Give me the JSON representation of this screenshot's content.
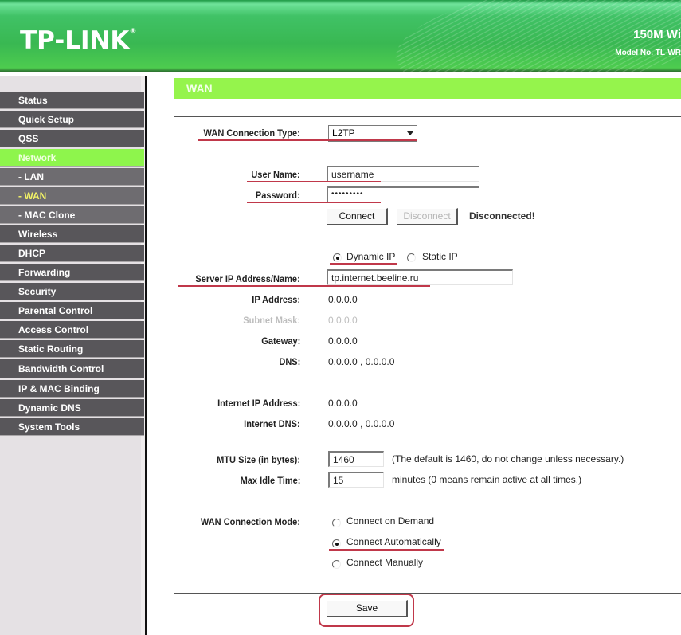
{
  "header": {
    "logo": "TP-LINK",
    "logo_mark": "®",
    "product_title": "150M Wi",
    "model_no": "Model No. TL-WR"
  },
  "sidebar": {
    "items": [
      {
        "label": "Status",
        "type": "top"
      },
      {
        "label": "Quick Setup",
        "type": "top"
      },
      {
        "label": "QSS",
        "type": "top"
      },
      {
        "label": "Network",
        "type": "active-parent"
      },
      {
        "label": "- LAN",
        "type": "sub"
      },
      {
        "label": "- WAN",
        "type": "sub-current"
      },
      {
        "label": "- MAC Clone",
        "type": "sub"
      },
      {
        "label": "Wireless",
        "type": "top"
      },
      {
        "label": "DHCP",
        "type": "top"
      },
      {
        "label": "Forwarding",
        "type": "top"
      },
      {
        "label": "Security",
        "type": "top"
      },
      {
        "label": "Parental Control",
        "type": "top"
      },
      {
        "label": "Access Control",
        "type": "top"
      },
      {
        "label": "Static Routing",
        "type": "top"
      },
      {
        "label": "Bandwidth Control",
        "type": "top"
      },
      {
        "label": "IP & MAC Binding",
        "type": "top"
      },
      {
        "label": "Dynamic DNS",
        "type": "top"
      },
      {
        "label": "System Tools",
        "type": "top"
      }
    ]
  },
  "main": {
    "section_title": "WAN",
    "connection_type": {
      "label": "WAN Connection Type:",
      "value": "L2TP"
    },
    "user_name": {
      "label": "User Name:",
      "value": "username"
    },
    "password": {
      "label": "Password:",
      "value": "•••••••••"
    },
    "connect_button": "Connect",
    "disconnect_button": "Disconnect",
    "connection_status": "Disconnected!",
    "ip_mode": {
      "dynamic_label": "Dynamic IP",
      "static_label": "Static IP",
      "selected": "Dynamic IP"
    },
    "server": {
      "label": "Server IP Address/Name:",
      "value": "tp.internet.beeline.ru"
    },
    "ip_address": {
      "label": "IP Address:",
      "value": "0.0.0.0"
    },
    "subnet_mask": {
      "label": "Subnet Mask:",
      "value": "0.0.0.0"
    },
    "gateway": {
      "label": "Gateway:",
      "value": "0.0.0.0"
    },
    "dns": {
      "label": "DNS:",
      "value": "0.0.0.0 , 0.0.0.0"
    },
    "internet_ip": {
      "label": "Internet IP Address:",
      "value": "0.0.0.0"
    },
    "internet_dns": {
      "label": "Internet DNS:",
      "value": "0.0.0.0 , 0.0.0.0"
    },
    "mtu": {
      "label": "MTU Size (in bytes):",
      "value": "1460",
      "hint": "(The default is 1460, do not change unless necessary.)"
    },
    "idle": {
      "label": "Max Idle Time:",
      "value": "15",
      "hint": "minutes (0 means remain active at all times.)"
    },
    "mode": {
      "label": "WAN Connection Mode:",
      "options": [
        "Connect on Demand",
        "Connect Automatically",
        "Connect Manually"
      ],
      "selected": "Connect Automatically"
    },
    "save_button": "Save"
  },
  "colors": {
    "accent_green": "#95f44c",
    "menu_bg": "#58565a",
    "annotation_red": "#c0384a"
  }
}
